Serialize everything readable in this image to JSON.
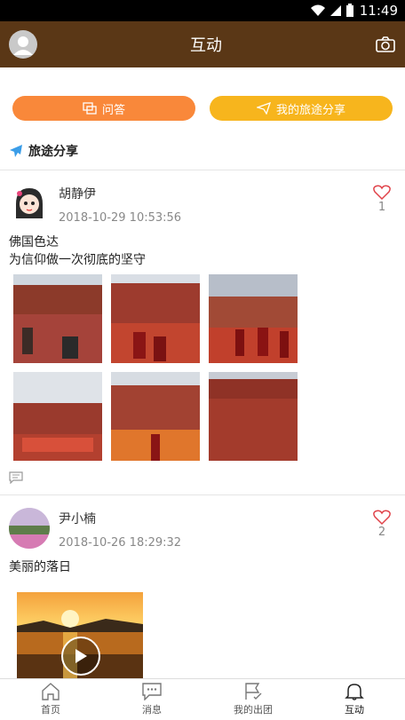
{
  "status_bar": {
    "time": "11:49"
  },
  "header": {
    "title": "互动"
  },
  "actions": {
    "qa_label": "问答",
    "share_label": "我的旅途分享"
  },
  "section": {
    "title": "旅途分享"
  },
  "posts": [
    {
      "user": "胡静伊",
      "time": "2018-10-29 10:53:56",
      "likes": "1",
      "text": "佛国色达\n为信仰做一次彻底的坚守"
    },
    {
      "user": "尹小楠",
      "time": "2018-10-26 18:29:32",
      "likes": "2",
      "text": "美丽的落日"
    }
  ],
  "tabs": [
    {
      "label": "首页",
      "icon": "home-icon"
    },
    {
      "label": "消息",
      "icon": "message-icon"
    },
    {
      "label": "我的出团",
      "icon": "flag-icon"
    },
    {
      "label": "互动",
      "icon": "bell-icon"
    }
  ],
  "colors": {
    "header": "#5a3716",
    "qa": "#f9883a",
    "share": "#f7b51d",
    "like": "#e0434a"
  }
}
